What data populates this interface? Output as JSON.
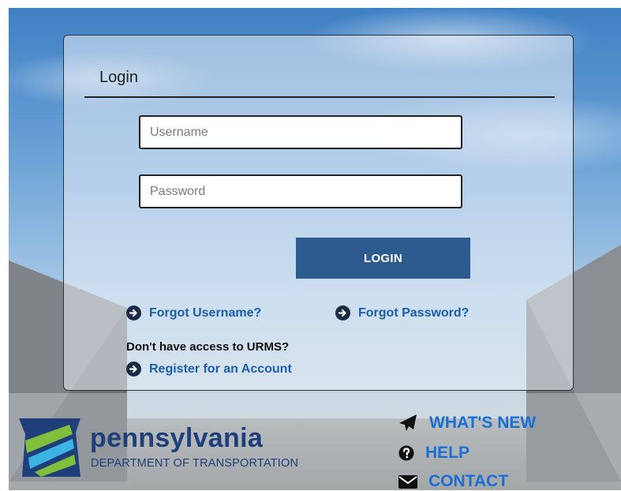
{
  "login": {
    "title": "Login",
    "username_placeholder": "Username",
    "password_placeholder": "Password",
    "login_button": "LOGIN",
    "forgot_username": "Forgot Username?",
    "forgot_password": "Forgot Password?",
    "no_access_text": "Don't have access to URMS?",
    "register_link": "Register for an Account"
  },
  "brand": {
    "name": "pennsylvania",
    "subtitle": "DEPARTMENT OF TRANSPORTATION"
  },
  "footer_links": {
    "whats_new": "WHAT'S NEW",
    "help": "HELP",
    "contact": "CONTACT"
  },
  "colors": {
    "button": "#2d5b90",
    "link": "#1a5fa8",
    "footer_link": "#1a6fd6",
    "brand": "#1e3f7a"
  },
  "icons": {
    "link_icon": "arrow-circle-right-icon",
    "whats_new": "paper-plane-icon",
    "help": "question-circle-icon",
    "contact": "envelope-icon"
  }
}
